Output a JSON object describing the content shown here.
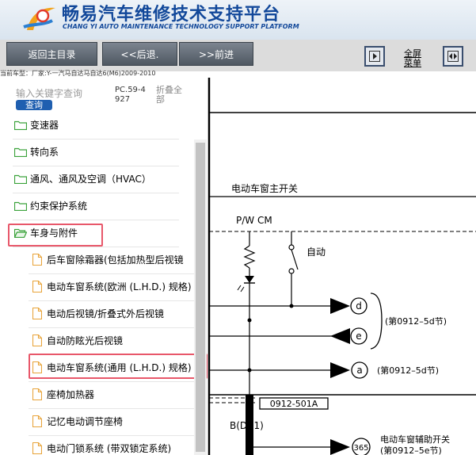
{
  "header": {
    "title": "畅易汽车维修技术支持平台",
    "subtitle": "CHANG YI AUTO MAINTENANCE TECHNOLOGY SUPPORT PLATFORM"
  },
  "toolbar": {
    "home_label": "返回主目录",
    "back_label": "<<后退.",
    "forward_label": ">>前进",
    "fullscreen_line1": "全屏",
    "fullscreen_line2": "菜单"
  },
  "model_line": "当前车型：厂家:Y-一汽马自达马自达6(M6)2009-2010",
  "sidebar": {
    "search_placeholder": "输入关键字查询",
    "search_button": "查询",
    "doc_code": "PC.59-4927",
    "collapse_all": "折叠全部",
    "categories": [
      {
        "label": "变速器"
      },
      {
        "label": "转向系"
      },
      {
        "label": "通风、通风及空调（HVAC）"
      },
      {
        "label": "约束保护系统"
      },
      {
        "label": "车身与附件"
      }
    ],
    "documents": [
      {
        "label": "后车窗除霜器(包括加热型后视镜"
      },
      {
        "label": "电动车窗系统(欧洲 (L.H.D.) 规格)"
      },
      {
        "label": "电动后视镜/折叠式外后视镜"
      },
      {
        "label": "自动防眩光后视镜"
      },
      {
        "label": "电动车窗系统(通用 (L.H.D.) 规格)"
      },
      {
        "label": "座椅加热器"
      },
      {
        "label": "记忆电动调节座椅"
      },
      {
        "label": "电动门锁系统 (带双锁定系统)"
      }
    ]
  },
  "diagram": {
    "title": "电动车窗主开关",
    "module_label": "P/W CM",
    "auto_label": "自动",
    "connector_d": "d",
    "connector_e": "e",
    "connector_a": "a",
    "ref_de": "(第0912–5d节)",
    "ref_a": "(第0912–5d节)",
    "connector_box": "0912-501A",
    "bus_label": "B(DR1)",
    "connector_365": "365",
    "aux_switch_label": "电动车窗辅助开关",
    "ref_365": "(第0912–5e节)"
  },
  "colors": {
    "brand_blue": "#12489a",
    "highlight": "#e8576a",
    "toolbar_button": "#5d666f",
    "folder_green": "#3aa23a",
    "file_orange": "#e8a43a"
  }
}
